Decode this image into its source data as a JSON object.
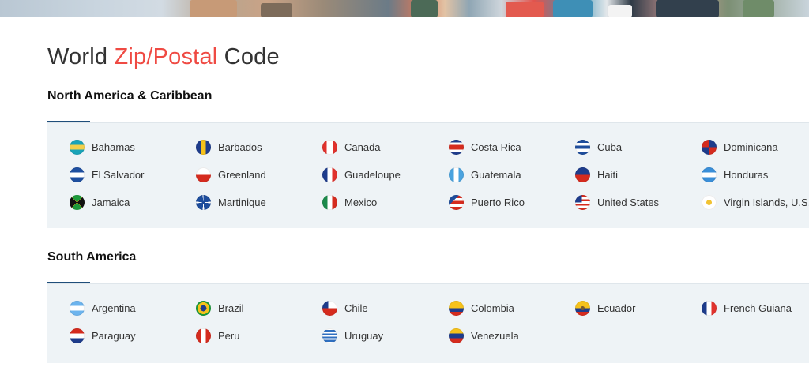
{
  "page": {
    "title_prefix": "World ",
    "title_accent": "Zip/Postal",
    "title_suffix": " Code"
  },
  "regions": [
    {
      "title": "North America & Caribbean",
      "countries": [
        {
          "name": "Bahamas",
          "icon": "bahamas-flag-icon"
        },
        {
          "name": "Barbados",
          "icon": "barbados-flag-icon"
        },
        {
          "name": "Canada",
          "icon": "canada-flag-icon"
        },
        {
          "name": "Costa Rica",
          "icon": "costa-rica-flag-icon"
        },
        {
          "name": "Cuba",
          "icon": "cuba-flag-icon"
        },
        {
          "name": "Dominicana",
          "icon": "dominicana-flag-icon"
        },
        {
          "name": "El Salvador",
          "icon": "el-salvador-flag-icon"
        },
        {
          "name": "Greenland",
          "icon": "greenland-flag-icon"
        },
        {
          "name": "Guadeloupe",
          "icon": "guadeloupe-flag-icon"
        },
        {
          "name": "Guatemala",
          "icon": "guatemala-flag-icon"
        },
        {
          "name": "Haiti",
          "icon": "haiti-flag-icon"
        },
        {
          "name": "Honduras",
          "icon": "honduras-flag-icon"
        },
        {
          "name": "Jamaica",
          "icon": "jamaica-flag-icon"
        },
        {
          "name": "Martinique",
          "icon": "martinique-flag-icon"
        },
        {
          "name": "Mexico",
          "icon": "mexico-flag-icon"
        },
        {
          "name": "Puerto Rico",
          "icon": "puerto-rico-flag-icon"
        },
        {
          "name": "United States",
          "icon": "united-states-flag-icon"
        },
        {
          "name": "Virgin Islands, U.S.",
          "icon": "virgin-islands-us-flag-icon"
        }
      ]
    },
    {
      "title": "South America",
      "countries": [
        {
          "name": "Argentina",
          "icon": "argentina-flag-icon"
        },
        {
          "name": "Brazil",
          "icon": "brazil-flag-icon"
        },
        {
          "name": "Chile",
          "icon": "chile-flag-icon"
        },
        {
          "name": "Colombia",
          "icon": "colombia-flag-icon"
        },
        {
          "name": "Ecuador",
          "icon": "ecuador-flag-icon"
        },
        {
          "name": "French Guiana",
          "icon": "french-guiana-flag-icon"
        },
        {
          "name": "Paraguay",
          "icon": "paraguay-flag-icon"
        },
        {
          "name": "Peru",
          "icon": "peru-flag-icon"
        },
        {
          "name": "Uruguay",
          "icon": "uruguay-flag-icon"
        },
        {
          "name": "Venezuela",
          "icon": "venezuela-flag-icon"
        }
      ]
    }
  ],
  "colors": {
    "accent": "#ef4a43",
    "underline": "#1f4e7a",
    "panel_background": "#eef3f6"
  }
}
